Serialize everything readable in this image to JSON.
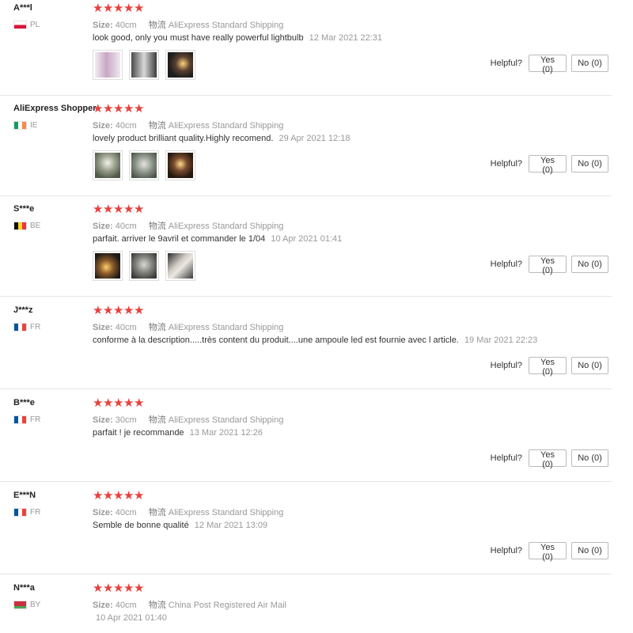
{
  "helpful_label": "Helpful?",
  "size_label": "Size:",
  "logistics_label": "物流",
  "reviews": [
    {
      "user": "A***l",
      "country": "PL",
      "flag": "pl",
      "size": "40cm",
      "shipping": "AliExpress Standard Shipping",
      "comment": "look good, only you must have really powerful lightbulb",
      "date": "12 Mar 2021 22:31",
      "yes": "Yes (0)",
      "no": "No (0)",
      "photos": [
        "photo",
        "photo",
        "photo"
      ]
    },
    {
      "user": "AliExpress Shopper",
      "country": "IE",
      "flag": "ie",
      "size": "40cm",
      "shipping": "AliExpress Standard Shipping",
      "comment": "lovely product brilliant quality.Highly recomend.",
      "date": "29 Apr 2021 12:18",
      "yes": "Yes (0)",
      "no": "No (0)",
      "photos": [
        "photo",
        "photo",
        "photo"
      ]
    },
    {
      "user": "S***e",
      "country": "BE",
      "flag": "be",
      "size": "40cm",
      "shipping": "AliExpress Standard Shipping",
      "comment": "parfait. arriver le 9avril et commander le 1/04",
      "date": "10 Apr 2021 01:41",
      "yes": "Yes (0)",
      "no": "No (0)",
      "photos": [
        "photo",
        "photo",
        "photo"
      ]
    },
    {
      "user": "J***z",
      "country": "FR",
      "flag": "fr",
      "size": "40cm",
      "shipping": "AliExpress Standard Shipping",
      "comment": "conforme à la description.....très content du produit....une ampoule led est fournie avec l article.",
      "date": "19 Mar 2021 22:23",
      "yes": "Yes (0)",
      "no": "No (0)",
      "photos": []
    },
    {
      "user": "B***e",
      "country": "FR",
      "flag": "fr",
      "size": "30cm",
      "shipping": "AliExpress Standard Shipping",
      "comment": "parfait ! je recommande",
      "date": "13 Mar 2021 12:26",
      "yes": "Yes (0)",
      "no": "No (0)",
      "photos": []
    },
    {
      "user": "E***N",
      "country": "FR",
      "flag": "fr",
      "size": "40cm",
      "shipping": "AliExpress Standard Shipping",
      "comment": "Semble de bonne qualité",
      "date": "12 Mar 2021 13:09",
      "yes": "Yes (0)",
      "no": "No (0)",
      "photos": []
    },
    {
      "user": "N***a",
      "country": "BY",
      "flag": "by",
      "size": "40cm",
      "shipping": "China Post Registered Air Mail",
      "comment": "",
      "date": "10 Apr 2021 01:40",
      "yes": "",
      "no": "",
      "photos": []
    }
  ],
  "rating_stars": 5,
  "colors": {
    "star": "#e8403c",
    "border": "#e6e6e6",
    "muted": "#999999"
  }
}
